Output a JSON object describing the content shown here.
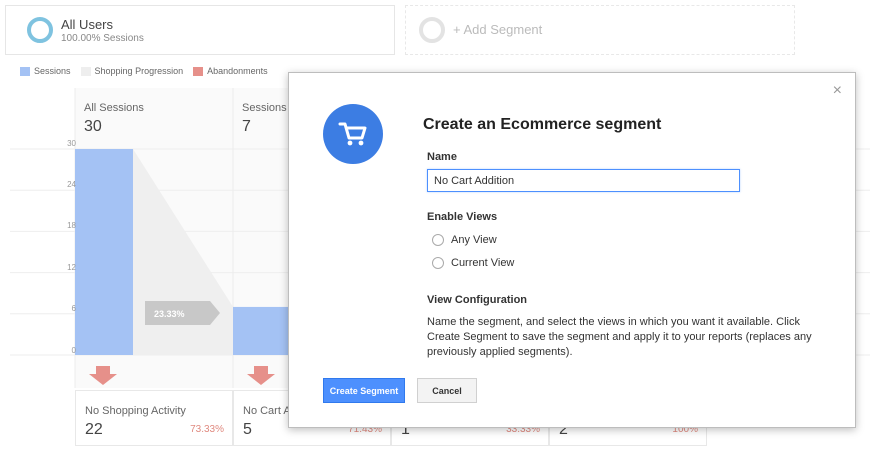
{
  "segments": {
    "all_users": {
      "title": "All Users",
      "subtitle": "100.00% Sessions"
    },
    "add_segment": {
      "label": "+ Add Segment"
    }
  },
  "legend": [
    {
      "label": "Sessions",
      "color": "#a4c2f4"
    },
    {
      "label": "Shopping Progression",
      "color": "#eeeeee"
    },
    {
      "label": "Abandonments",
      "color": "#e6908a"
    }
  ],
  "funnel": {
    "y_ticks": [
      "30",
      "24",
      "18",
      "12",
      "6",
      "0"
    ],
    "columns": [
      {
        "label": "All Sessions",
        "value": "30"
      },
      {
        "label": "Sessions",
        "value": "7"
      }
    ],
    "progression_pct": "23.33%",
    "abandonments": [
      {
        "label": "No Shopping Activity",
        "value": "22",
        "pct": "73.33%"
      },
      {
        "label": "No Cart A",
        "value": "5",
        "pct": "71.43%"
      },
      {
        "label": "",
        "value": "1",
        "pct": "33.33%"
      },
      {
        "label": "",
        "value": "2",
        "pct": "100%"
      }
    ]
  },
  "chart_data": {
    "type": "bar",
    "categories": [
      "All Sessions",
      "Sessions"
    ],
    "values": [
      30,
      7
    ],
    "ylim": [
      0,
      30
    ],
    "yticks": [
      0,
      6,
      12,
      18,
      24,
      30
    ],
    "progression_pct": "23.33%"
  },
  "modal": {
    "title": "Create an Ecommerce segment",
    "name_label": "Name",
    "name_value": "No Cart Addition",
    "enable_views_label": "Enable Views",
    "views": [
      "Any View",
      "Current View"
    ],
    "view_config_label": "View Configuration",
    "view_config_text": "Name the segment, and select the views in which you want it available. Click Create Segment to save the segment and apply it to your reports (replaces any previously applied segments).",
    "create_button": "Create Segment",
    "cancel_button": "Cancel",
    "close_glyph": "×"
  }
}
